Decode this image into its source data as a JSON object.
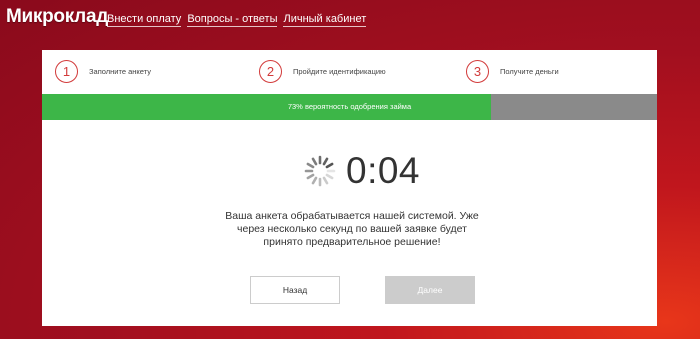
{
  "header": {
    "logo": "Микроклад",
    "nav": [
      "Внести оплату",
      "Вопросы - ответы",
      "Личный кабинет"
    ]
  },
  "steps": [
    {
      "num": "1",
      "label": "Заполните анкету"
    },
    {
      "num": "2",
      "label": "Пройдите идентификацию"
    },
    {
      "num": "3",
      "label": "Получите деньги"
    }
  ],
  "progress": {
    "percent": 73,
    "label": "73% вероятность одобрения займа"
  },
  "timer": "0:04",
  "message": "Ваша анкета обрабатывается нашей системой. Уже через несколько секунд по вашей заявке будет принято предварительное решение!",
  "buttons": {
    "back": "Назад",
    "next": "Далее"
  },
  "colors": {
    "brand_red": "#b5121b",
    "step_red": "#d23a3a",
    "progress_green": "#3db648",
    "progress_track": "#8a8a8a",
    "disabled_button": "#cccccc"
  },
  "icons": {
    "spinner": "loading-spinner-icon"
  }
}
